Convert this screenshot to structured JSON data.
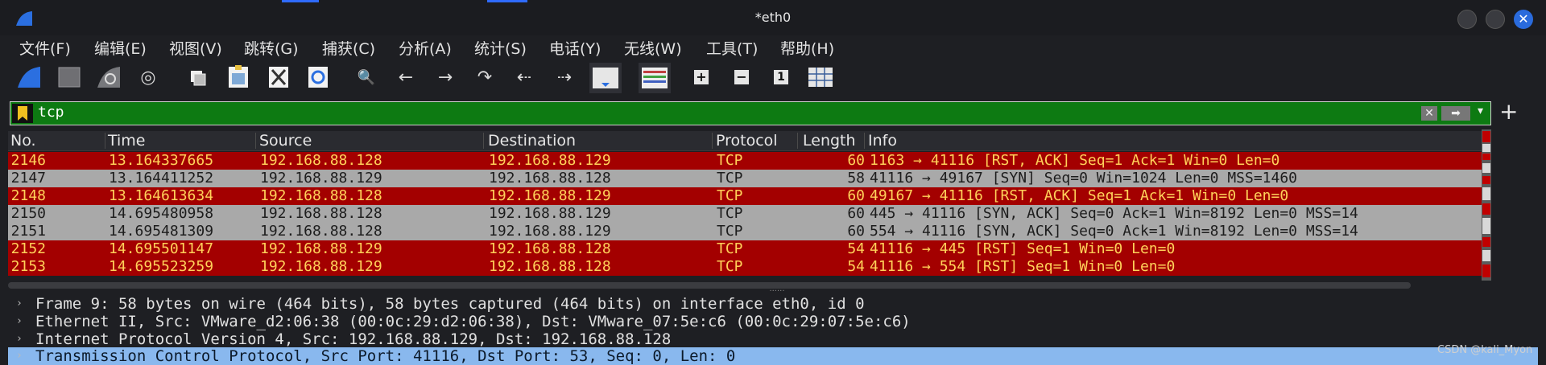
{
  "window": {
    "title": "*eth0",
    "close_glyph": "✕"
  },
  "menu": [
    "文件(F)",
    "编辑(E)",
    "视图(V)",
    "跳转(G)",
    "捕获(C)",
    "分析(A)",
    "统计(S)",
    "电话(Y)",
    "无线(W)",
    "工具(T)",
    "帮助(H)"
  ],
  "toolbar": {
    "icons": [
      "start-capture-icon",
      "stop-capture-icon",
      "restart-capture-icon",
      "capture-options-icon",
      "open-file-icon",
      "save-file-icon",
      "close-file-icon",
      "reload-file-icon",
      "find-packet-icon",
      "go-back-icon",
      "go-forward-icon",
      "go-to-packet-icon",
      "first-packet-icon",
      "last-packet-icon",
      "autoscroll-icon",
      "colorize-icon",
      "zoom-in-icon",
      "zoom-out-icon",
      "normal-size-icon",
      "resize-columns-icon"
    ],
    "glyphs": [
      "",
      "",
      "",
      "◎",
      "",
      "",
      "",
      "",
      "🔍",
      "←",
      "→",
      "↷",
      "⇠",
      "⇢",
      "",
      "",
      "+",
      "−",
      "1",
      ""
    ]
  },
  "filter": {
    "value": "tcp",
    "clear_glyph": "✕",
    "apply_glyph": "➡",
    "dropdown_glyph": "▾",
    "add_glyph": "+"
  },
  "packet_list": {
    "columns": [
      "No.",
      "Time",
      "Source",
      "Destination",
      "Protocol",
      "Length",
      "Info"
    ],
    "rows": [
      {
        "style": "red",
        "no": "2146",
        "time": "13.164337665",
        "src": "192.168.88.128",
        "dst": "192.168.88.129",
        "proto": "TCP",
        "len": "60",
        "info": "1163 → 41116 [RST, ACK] Seq=1 Ack=1 Win=0 Len=0"
      },
      {
        "style": "grey",
        "no": "2147",
        "time": "13.164411252",
        "src": "192.168.88.129",
        "dst": "192.168.88.128",
        "proto": "TCP",
        "len": "58",
        "info": "41116 → 49167 [SYN] Seq=0 Win=1024 Len=0 MSS=1460"
      },
      {
        "style": "red",
        "no": "2148",
        "time": "13.164613634",
        "src": "192.168.88.128",
        "dst": "192.168.88.129",
        "proto": "TCP",
        "len": "60",
        "info": "49167 → 41116 [RST, ACK] Seq=1 Ack=1 Win=0 Len=0"
      },
      {
        "style": "grey",
        "no": "2150",
        "time": "14.695480958",
        "src": "192.168.88.128",
        "dst": "192.168.88.129",
        "proto": "TCP",
        "len": "60",
        "info": "445 → 41116 [SYN, ACK] Seq=0 Ack=1 Win=8192 Len=0 MSS=14"
      },
      {
        "style": "grey",
        "no": "2151",
        "time": "14.695481309",
        "src": "192.168.88.128",
        "dst": "192.168.88.129",
        "proto": "TCP",
        "len": "60",
        "info": "554 → 41116 [SYN, ACK] Seq=0 Ack=1 Win=8192 Len=0 MSS=14"
      },
      {
        "style": "red",
        "no": "2152",
        "time": "14.695501147",
        "src": "192.168.88.129",
        "dst": "192.168.88.128",
        "proto": "TCP",
        "len": "54",
        "info": "41116 → 445 [RST] Seq=1 Win=0 Len=0"
      },
      {
        "style": "red",
        "no": "2153",
        "time": "14.695523259",
        "src": "192.168.88.129",
        "dst": "192.168.88.128",
        "proto": "TCP",
        "len": "54",
        "info": "41116 → 554 [RST] Seq=1 Win=0 Len=0"
      }
    ]
  },
  "details": {
    "expand_glyph": "›",
    "rows": [
      "Frame 9: 58 bytes on wire (464 bits), 58 bytes captured (464 bits) on interface eth0, id 0",
      "Ethernet II, Src: VMware_d2:06:38 (00:0c:29:d2:06:38), Dst: VMware_07:5e:c6 (00:0c:29:07:5e:c6)",
      "Internet Protocol Version 4, Src: 192.168.88.129, Dst: 192.168.88.128",
      "Transmission Control Protocol, Src Port: 41116, Dst Port: 53, Seq: 0, Len: 0"
    ],
    "selected_index": 3
  },
  "watermark": "CSDN @kali_Myon",
  "colors": {
    "red_row": "#a30000",
    "grey_row": "#a9a9a9",
    "filter_valid": "#0d7a12",
    "selected_detail": "#89b8ee"
  }
}
